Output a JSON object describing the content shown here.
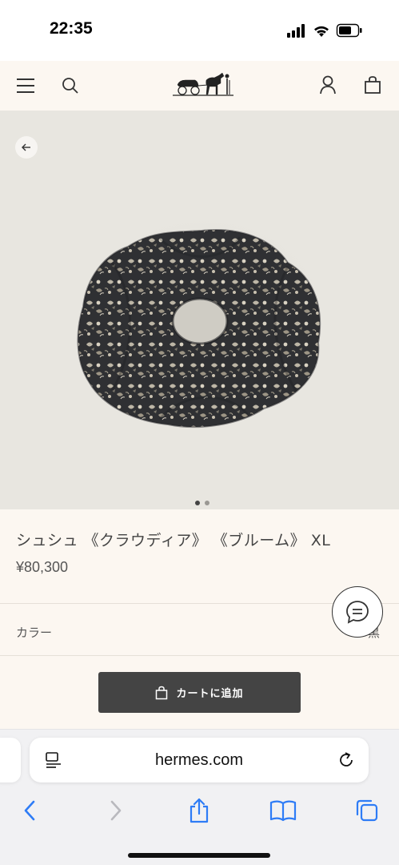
{
  "status_bar": {
    "time": "22:35"
  },
  "header": {
    "menu_icon": "hamburger-menu-icon",
    "search_icon": "search-icon",
    "logo": "hermes-carriage-logo",
    "account_icon": "user-icon",
    "bag_icon": "shopping-bag-icon"
  },
  "hero": {
    "back_icon": "arrow-left-icon",
    "image_count": 2,
    "active_index": 0
  },
  "product": {
    "title": "シュシュ 《クラウディア》 《ブルーム》 XL",
    "price": "¥80,300",
    "color_label": "カラー",
    "color_value": "黒",
    "add_to_cart": "カートに追加"
  },
  "browser": {
    "url": "hermes.com",
    "toolbar": [
      "back-icon",
      "forward-icon",
      "share-icon",
      "bookmarks-icon",
      "tabs-icon"
    ]
  },
  "colors": {
    "header_bg": "#fcf7f1",
    "hero_bg": "#e8e6e0",
    "button_bg": "#444444",
    "ios_blue": "#2e7cf6"
  }
}
